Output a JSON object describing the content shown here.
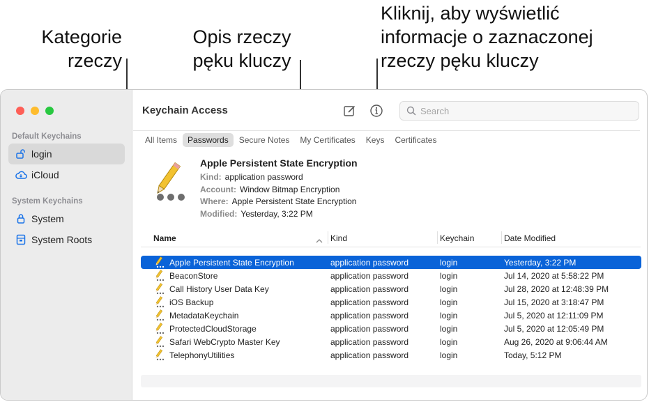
{
  "callouts": {
    "categories": [
      "Kategorie",
      "rzeczy"
    ],
    "description": [
      "Opis rzeczy",
      "pęku kluczy"
    ],
    "info": [
      "Kliknij, aby wyświetlić",
      "informacje o zaznaczonej",
      "rzeczy pęku kluczy"
    ]
  },
  "window": {
    "title": "Keychain Access",
    "search_placeholder": "Search"
  },
  "sidebar": {
    "default_heading": "Default Keychains",
    "default_items": [
      {
        "label": "login",
        "icon": "lock-open-icon"
      },
      {
        "label": "iCloud",
        "icon": "icloud-icon"
      }
    ],
    "system_heading": "System Keychains",
    "system_items": [
      {
        "label": "System",
        "icon": "lock-icon"
      },
      {
        "label": "System Roots",
        "icon": "cabinet-icon"
      }
    ]
  },
  "tabs": [
    "All Items",
    "Passwords",
    "Secure Notes",
    "My Certificates",
    "Keys",
    "Certificates"
  ],
  "selected_tab": "Passwords",
  "detail": {
    "name": "Apple Persistent State Encryption",
    "kind_label": "Kind:",
    "kind": "application password",
    "account_label": "Account:",
    "account": "Window Bitmap Encryption",
    "where_label": "Where:",
    "where": "Apple Persistent State Encryption",
    "modified_label": "Modified:",
    "modified": "Yesterday, 3:22 PM"
  },
  "table": {
    "columns": [
      "Name",
      "Kind",
      "Keychain",
      "Date Modified"
    ],
    "rows": [
      [
        "Apple Persistent State Encryption",
        "application password",
        "login",
        "Yesterday, 3:22 PM"
      ],
      [
        "BeaconStore",
        "application password",
        "login",
        "Jul 14, 2020 at 5:58:22 PM"
      ],
      [
        "Call History User Data Key",
        "application password",
        "login",
        "Jul 28, 2020 at 12:48:39 PM"
      ],
      [
        "iOS Backup",
        "application password",
        "login",
        "Jul 15, 2020 at 3:18:47 PM"
      ],
      [
        "MetadataKeychain",
        "application password",
        "login",
        "Jul 5, 2020 at 12:11:09 PM"
      ],
      [
        "ProtectedCloudStorage",
        "application password",
        "login",
        "Jul 5, 2020 at 12:05:49 PM"
      ],
      [
        "Safari WebCrypto Master Key",
        "application password",
        "login",
        "Aug 26, 2020 at 9:06:44 AM"
      ],
      [
        "TelephonyUtilities",
        "application password",
        "login",
        "Today, 5:12 PM"
      ]
    ]
  },
  "colors": {
    "selection": "#0a63d8",
    "sidebar_bg": "#ececec"
  }
}
